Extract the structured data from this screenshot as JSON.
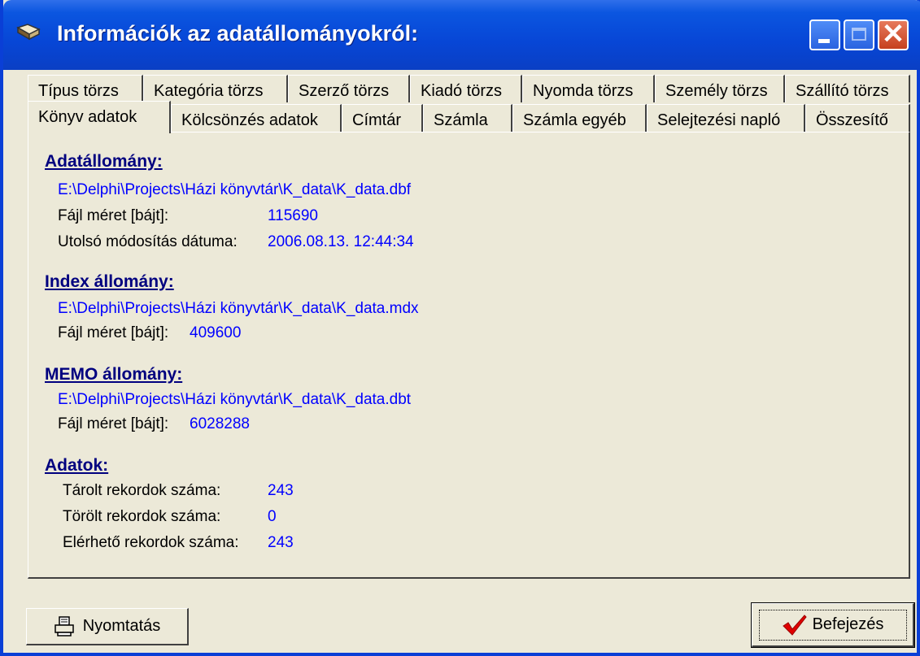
{
  "window": {
    "title": "Információk az adatállományokról:",
    "close_glyph": "✕"
  },
  "tabs_back": [
    "Típus törzs",
    "Kategória törzs",
    "Szerző törzs",
    "Kiadó törzs",
    "Nyomda törzs",
    "Személy törzs",
    "Szállító törzs"
  ],
  "tabs_front": [
    "Könyv adatok",
    "Kölcsönzés adatok",
    "Címtár",
    "Számla",
    "Számla egyéb",
    "Selejtezési napló",
    "Összesítő"
  ],
  "active_tab": "Könyv adatok",
  "data_file": {
    "heading": "Adatállomány:",
    "path": "E:\\Delphi\\Projects\\Házi könyvtár\\K_data\\K_data.dbf",
    "size_label": "Fájl méret [bájt]:",
    "size_value": "115690",
    "modified_label": "Utolsó módosítás dátuma:",
    "modified_value": "2006.08.13. 12:44:34"
  },
  "index_file": {
    "heading": "Index állomány:",
    "path": "E:\\Delphi\\Projects\\Házi könyvtár\\K_data\\K_data.mdx",
    "size_label": "Fájl méret [bájt]:",
    "size_value": "409600"
  },
  "memo_file": {
    "heading": "MEMO állomány:",
    "path": "E:\\Delphi\\Projects\\Házi könyvtár\\K_data\\K_data.dbt",
    "size_label": "Fájl méret [bájt]:",
    "size_value": "6028288"
  },
  "records": {
    "heading": "Adatok:",
    "stored_label": "Tárolt rekordok száma:",
    "stored_value": "243",
    "deleted_label": "Törölt rekordok száma:",
    "deleted_value": "0",
    "available_label": "Elérhető rekordok száma:",
    "available_value": "243"
  },
  "buttons": {
    "print_label": "Nyomtatás",
    "done_label": "Befejezés"
  },
  "icons": {
    "title": "book-icon",
    "print": "printer-icon",
    "done": "checkmark-icon"
  }
}
